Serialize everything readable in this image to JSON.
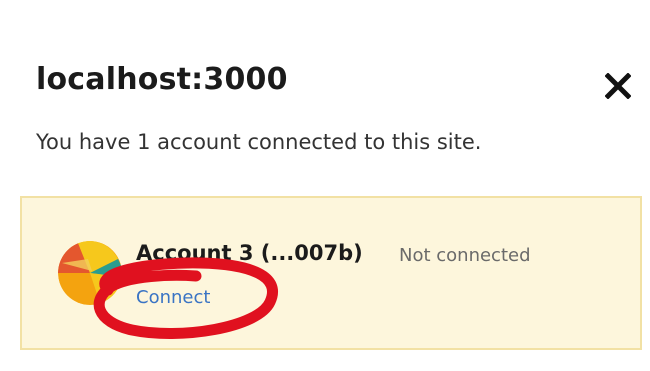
{
  "header": {
    "title": "localhost:3000",
    "close_icon": "close-icon"
  },
  "summary": {
    "text": "You have 1 account connected to this site."
  },
  "account": {
    "name": "Account 3 (...007b)",
    "status": "Not connected",
    "connect_label": "Connect",
    "avatar_icon": "avatar-identicon"
  },
  "colors": {
    "card_background": "#fdf6dc",
    "card_border": "#f2e1a4",
    "link": "#3a74c4",
    "annotation": "#e0111f"
  }
}
